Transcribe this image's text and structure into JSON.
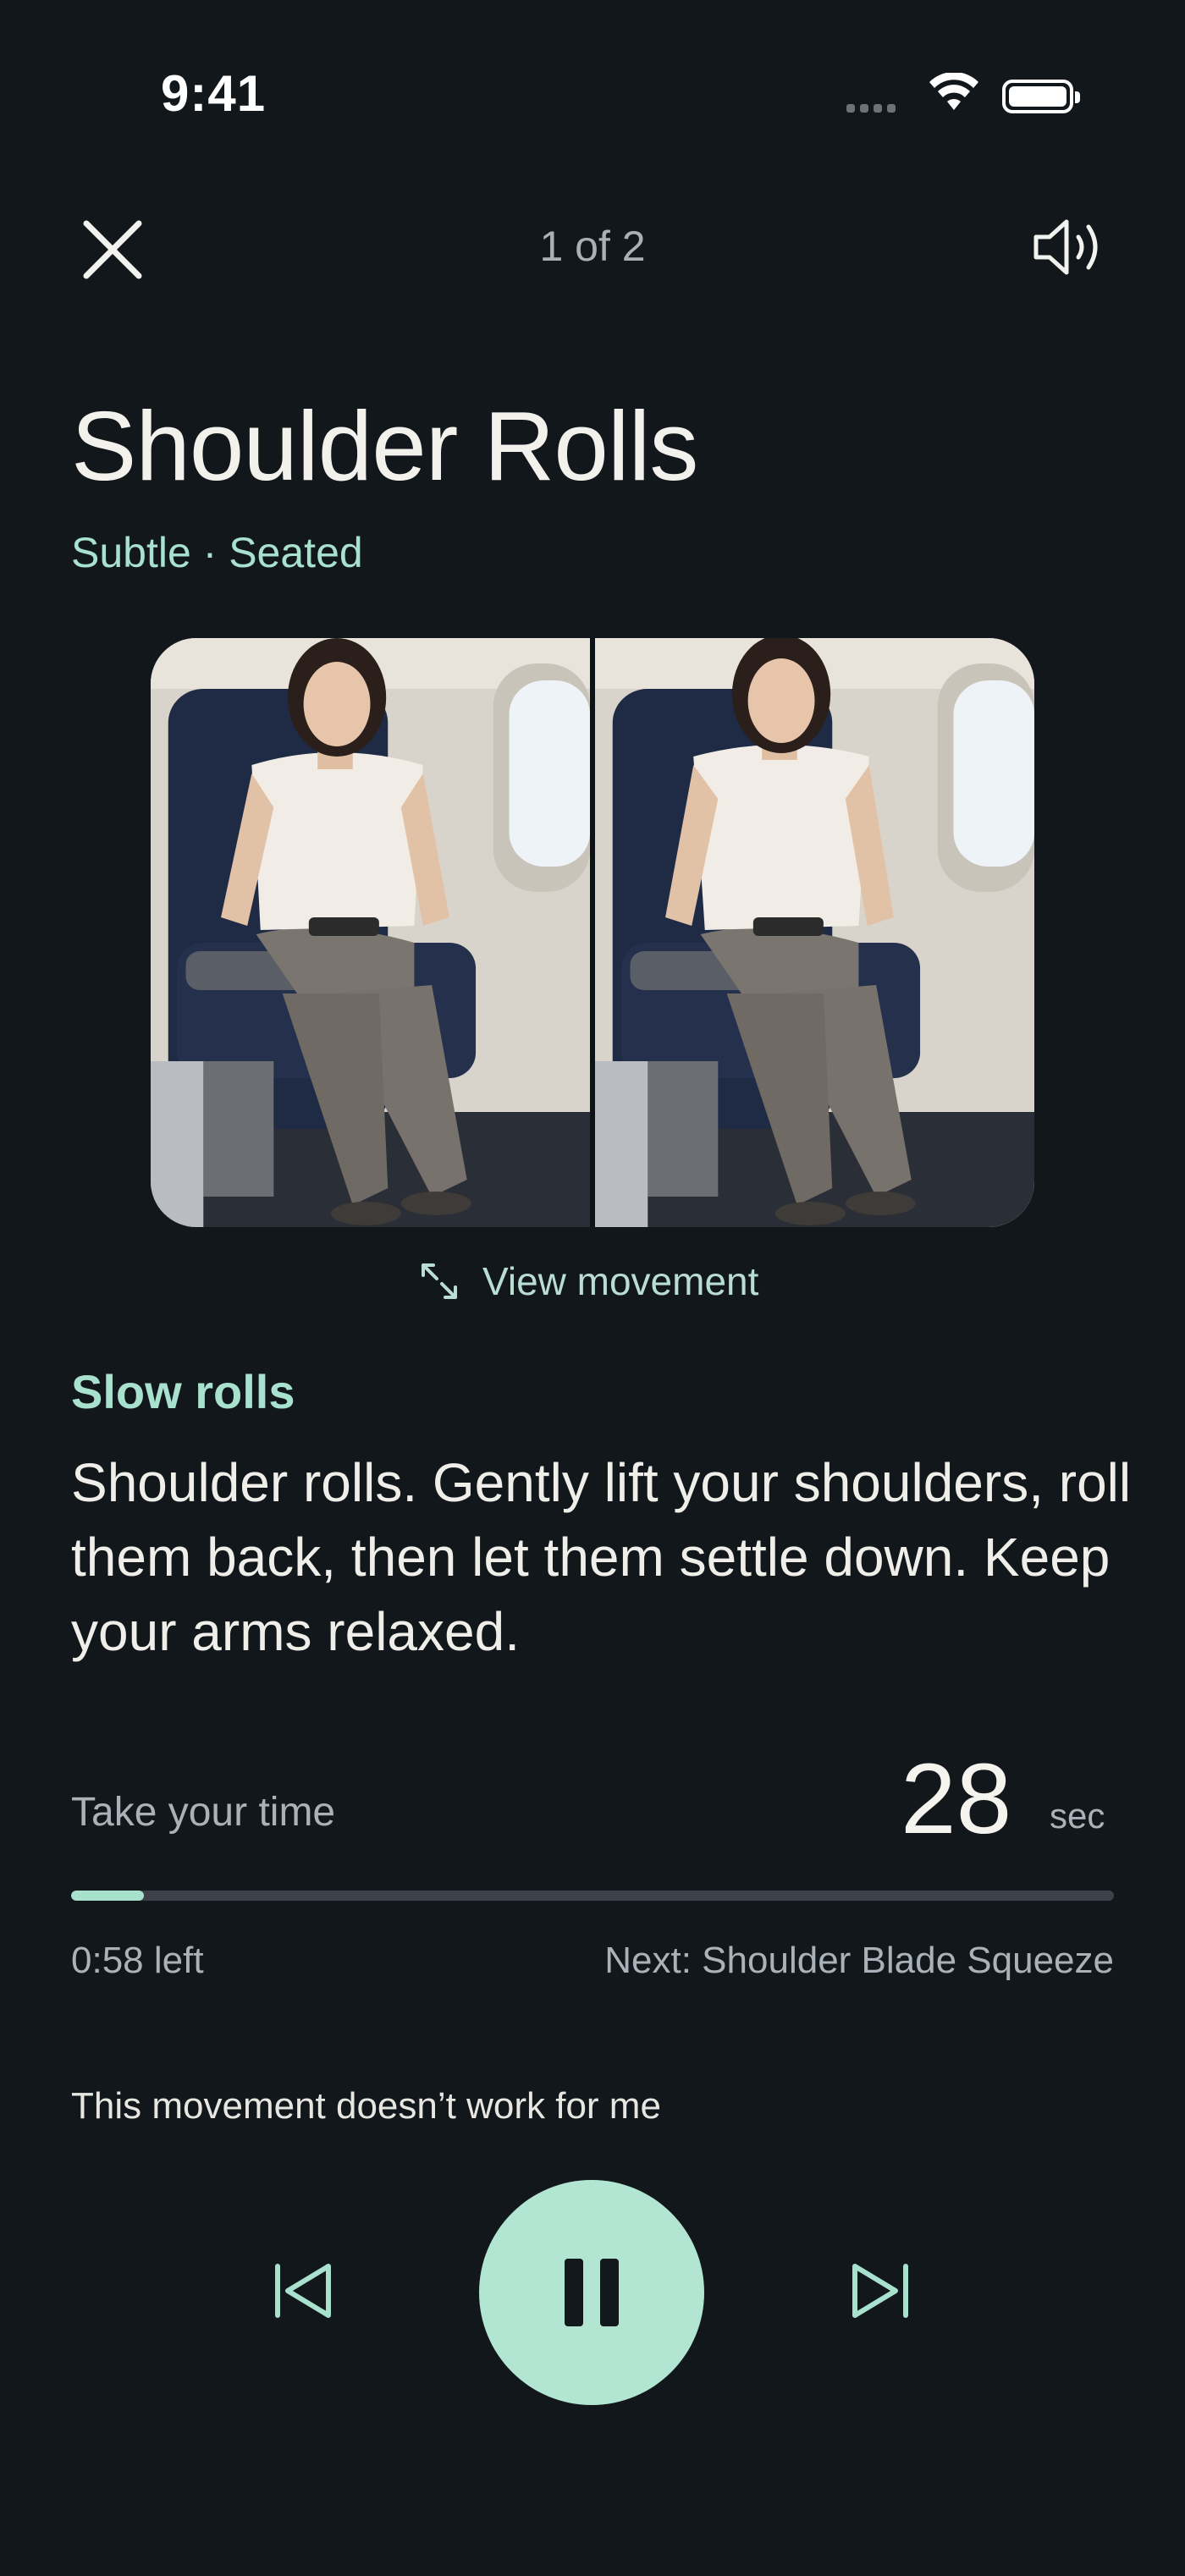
{
  "status_bar": {
    "time": "9:41"
  },
  "header": {
    "counter": "1 of 2",
    "close_icon": "close-icon",
    "sound_icon": "speaker-icon"
  },
  "exercise": {
    "title": "Shoulder Rolls",
    "tags": "Subtle · Seated",
    "view_movement_label": "View movement",
    "view_movement_icon": "expand-icon",
    "step_label": "Slow rolls",
    "instruction": "Shoulder rolls. Gently lift your shoulders, roll them back, then let them settle down. Keep your arms relaxed."
  },
  "timer": {
    "prompt": "Take your time",
    "seconds": "28",
    "unit": "sec",
    "progress_fraction": 0.07,
    "remaining": "0:58 left",
    "next": "Next: Shoulder Blade Squeeze"
  },
  "feedback_link": "This movement doesn’t work for me",
  "controls": {
    "previous_icon": "skip-previous-icon",
    "pause_icon": "pause-icon",
    "next_icon": "skip-next-icon"
  },
  "colors": {
    "background": "#12171c",
    "accent": "#a8e1ce",
    "play_button": "#b3e5d3"
  }
}
